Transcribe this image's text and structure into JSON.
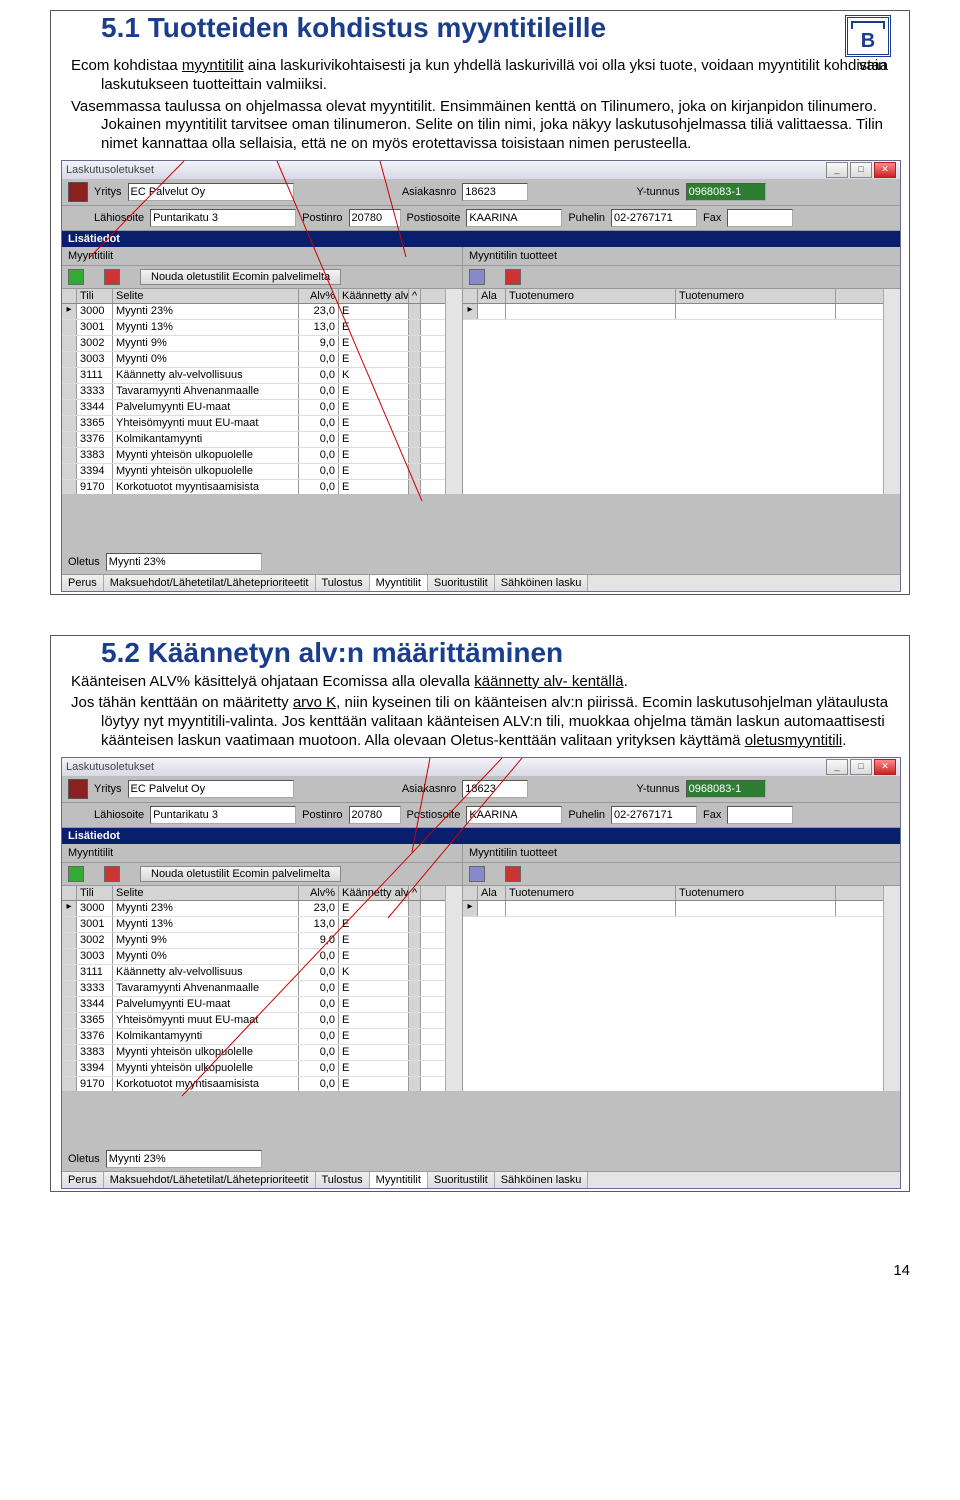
{
  "section1": {
    "title": "5.1 Tuotteiden kohdistus myyntitileille",
    "vain": "vain",
    "para1a": "Ecom kohdistaa ",
    "para1_ul": "myyntitilit",
    "para1b": " aina laskurivikohtaisesti ja kun yhdellä laskurivillä voi olla yksi tuote, voidaan myyntitilit kohdistaa laskutukseen tuotteittain valmiiksi.",
    "para2": "Vasemmassa taulussa on ohjelmassa olevat myyntitilit. Ensimmäinen kenttä on Tilinumero, joka on kirjanpidon tilinumero. Jokainen myyntitilit tarvitsee oman tilinumeron. Selite on tilin nimi, joka näkyy laskutusohjelmassa tiliä valittaessa. Tilin nimet kannattaa olla sellaisia, että ne on myös erotettavissa toisistaan nimen perusteella."
  },
  "section2": {
    "title": "5.2 Käännetyn alv:n määrittäminen",
    "p1a": "Käänteisen ALV% käsittelyä ohjataan Ecomissa alla olevalla ",
    "p1_ul": "käännetty alv- kentällä",
    "p1b": ".",
    "p2a": "Jos tähän kenttään on määritetty ",
    "p2_ul1": "arvo K",
    "p2b": ", niin kyseinen tili on käänteisen alv:n piirissä. Ecomin laskutusohjelman ylätaulusta löytyy nyt myyntitili-valinta. Jos kenttään valitaan käänteisen ALV:n tili, muokkaa ohjelma tämän laskun automaattisesti käänteisen laskun vaatimaan muotoon. Alla olevaan Oletus-kenttään valitaan yrityksen käyttämä ",
    "p2_ul2": "oletusmyyntitili",
    "p2c": "."
  },
  "window": {
    "title": "Laskutusoletukset",
    "header": {
      "yritys_lbl": "Yritys",
      "yritys": "EC Palvelut Oy",
      "asiakas_lbl": "Asiakasnro",
      "asiakas": "18623",
      "ytunnus_lbl": "Y-tunnus",
      "ytunnus": "0968083-1",
      "lahi_lbl": "Lähiosoite",
      "lahi": "Puntarikatu 3",
      "postinro_lbl": "Postinro",
      "postinro": "20780",
      "postios_lbl": "Postiosoite",
      "postios": "KAARINA",
      "puh_lbl": "Puhelin",
      "puh": "02-2767171",
      "fax_lbl": "Fax",
      "fax": ""
    },
    "bar_lisa": "Lisätiedot",
    "left_pane_title": "Myyntitilit",
    "right_pane_title": "Myyntitilin tuotteet",
    "btn_nouda": "Nouda oletustilit Ecomin palvelimelta",
    "left_cols": {
      "tili": "Tili",
      "selite": "Selite",
      "alv": "Alv%",
      "kaan": "Käännetty alv"
    },
    "right_cols": {
      "ala": "Ala",
      "tn1": "Tuotenumero",
      "tn2": "Tuotenumero"
    },
    "oletus_lbl": "Oletus",
    "oletus_val": "Myynti 23%",
    "tabs": [
      "Perus",
      "Maksuehdot/Lähetetilat/Läheteprioriteetit",
      "Tulostus",
      "Myyntitilit",
      "Suoritustilit",
      "Sähköinen lasku"
    ]
  },
  "chart_data": {
    "type": "table",
    "columns": [
      "Tili",
      "Selite",
      "Alv%",
      "Käännetty alv"
    ],
    "rows": [
      [
        "3000",
        "Myynti 23%",
        "23,0",
        "E"
      ],
      [
        "3001",
        "Myynti 13%",
        "13,0",
        "E"
      ],
      [
        "3002",
        "Myynti 9%",
        "9,0",
        "E"
      ],
      [
        "3003",
        "Myynti 0%",
        "0,0",
        "E"
      ],
      [
        "3111",
        "Käännetty alv-velvollisuus",
        "0,0",
        "K"
      ],
      [
        "3333",
        "Tavaramyynti Ahvenanmaalle",
        "0,0",
        "E"
      ],
      [
        "3344",
        "Palvelumyynti EU-maat",
        "0,0",
        "E"
      ],
      [
        "3365",
        "Yhteisömyynti muut EU-maat",
        "0,0",
        "E"
      ],
      [
        "3376",
        "Kolmikantamyynti",
        "0,0",
        "E"
      ],
      [
        "3383",
        "Myynti yhteisön ulkopuolelle",
        "0,0",
        "E"
      ],
      [
        "3394",
        "Myynti yhteisön ulkopuolelle",
        "0,0",
        "E"
      ],
      [
        "9170",
        "Korkotuotot myyntisaamisista",
        "0,0",
        "E"
      ]
    ]
  },
  "page_num": "14"
}
